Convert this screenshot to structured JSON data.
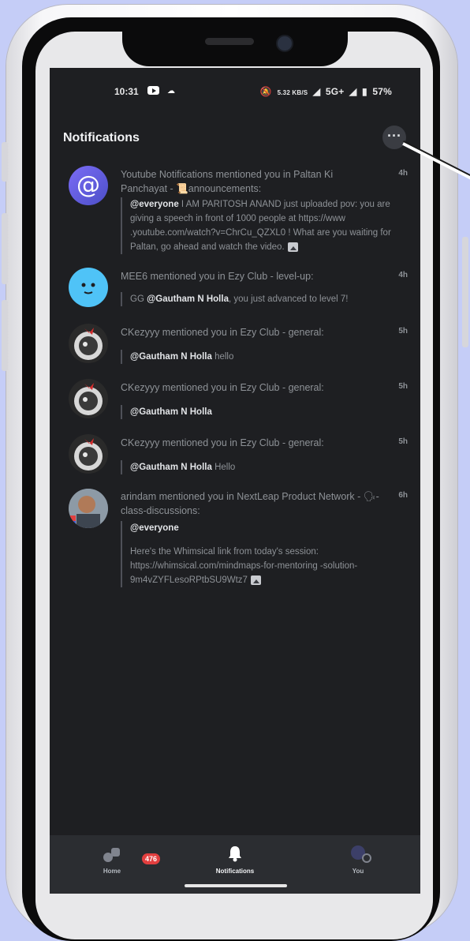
{
  "status": {
    "time": "10:31",
    "speed": "5.32 KB/S",
    "network": "5G+",
    "battery": "57%"
  },
  "header": {
    "title": "Notifications",
    "more_label": "···"
  },
  "notifications": [
    {
      "title": "Youtube Notifications mentioned you in Paltan Ki Panchayat - 📜announcements:",
      "time": "4h",
      "mention": "@everyone",
      "body": " I AM PARITOSH ANAND just uploaded pov: you are giving a speech in front of 1000 people at https://www .youtube.com/watch?v=ChrCu_QZXL0 ! What are you waiting for Paltan, go ahead and watch the video."
    },
    {
      "title": "MEE6 mentioned you in Ezy Club - level-up:",
      "time": "4h",
      "pre": "GG ",
      "mention": "@Gautham N Holla",
      "body": ", you just advanced to level 7!"
    },
    {
      "title": "CKezyyy mentioned you in Ezy Club - general:",
      "time": "5h",
      "mention": "@Gautham N Holla",
      "body": " hello"
    },
    {
      "title": "CKezyyy mentioned you in Ezy Club - general:",
      "time": "5h",
      "mention": "@Gautham N Holla",
      "body": ""
    },
    {
      "title": "CKezyyy mentioned you in Ezy Club - general:",
      "time": "5h",
      "mention": "@Gautham N Holla",
      "body": "  Hello"
    },
    {
      "title": "arindam mentioned you in NextLeap Product Network - 🗣-class-discussions:",
      "time": "6h",
      "mention": "@everyone",
      "body": "Here's the Whimsical link from today's session: https://whimsical.com/mindmaps-for-mentoring -solution-9m4vZYFLesoRPtbSU9Wtz7"
    }
  ],
  "tabs": {
    "home": "Home",
    "home_badge": "476",
    "notifications": "Notifications",
    "you": "You"
  }
}
